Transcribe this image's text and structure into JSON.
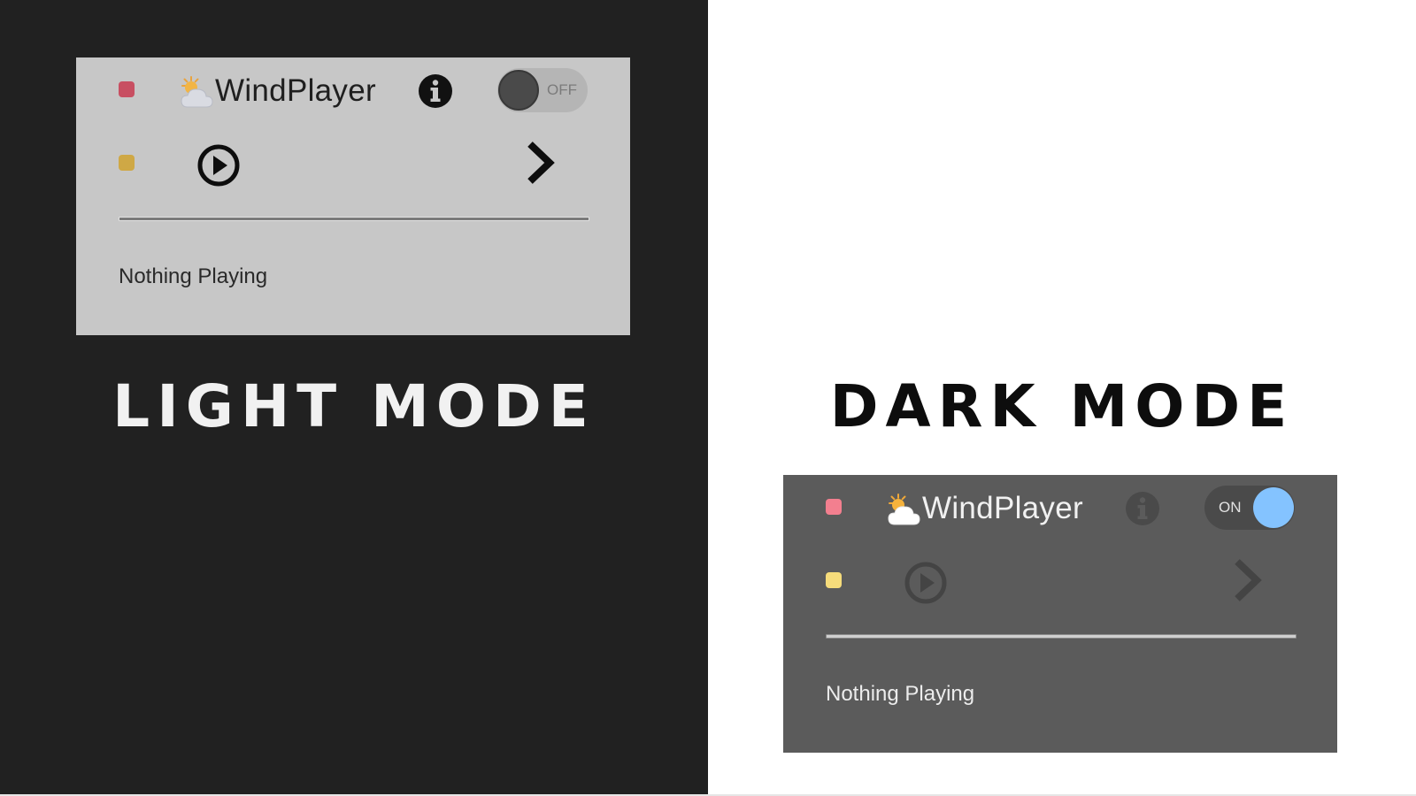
{
  "light_panel": {
    "app_title": "WindPlayer",
    "toggle_label": "OFF",
    "now_playing": "Nothing Playing",
    "caption": "LIGHT MODE",
    "progress": 0
  },
  "dark_panel": {
    "app_title": "WindPlayer",
    "toggle_label": "ON",
    "now_playing": "Nothing Playing",
    "caption": "DARK MODE",
    "progress": 0
  },
  "icons": {
    "close": "close-dot-icon",
    "minimize": "minimize-dot-icon",
    "weather": "weather-partly-cloudy-icon",
    "info": "info-icon",
    "play": "play-circle-icon",
    "next": "chevron-right-icon"
  },
  "colors": {
    "left_background": "#212121",
    "right_background": "#ffffff",
    "light_panel_bg": "#c7c7c7",
    "dark_panel_bg": "#5b5b5b",
    "toggle_on_knob": "#84c3ff",
    "close_light": "#c84f62",
    "minimize_light": "#cfa845",
    "close_dark": "#f37f8f",
    "minimize_dark": "#f6dc7b"
  }
}
